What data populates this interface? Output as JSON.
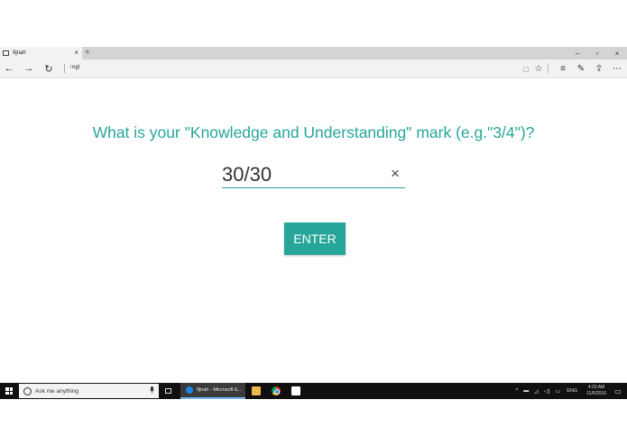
{
  "browser": {
    "tab_title": "9jnah",
    "tab_close": "×",
    "new_tab": "+",
    "window_controls": {
      "minimize": "–",
      "restore": "▫",
      "close": "×"
    },
    "address_text": "↑ngl",
    "nav": {
      "back": "←",
      "forward": "→",
      "refresh": "↻"
    },
    "toolbar_icons": {
      "reading_view": "▢",
      "favorite": "☆",
      "hub": "≡",
      "web_note": "✎",
      "share": "⇪",
      "more": "⋯"
    }
  },
  "page": {
    "question": "What is your \"Knowledge and Understanding\" mark (e.g.\"3/4\")?",
    "input_value": "30/30",
    "clear_glyph": "×",
    "enter_label": "ENTER",
    "accent_color": "#26a69a"
  },
  "taskbar": {
    "search_placeholder": "Ask me anything",
    "mic_glyph": "🎤",
    "active_app_label": "9jnah - Microsoft E...",
    "tray": {
      "chevron": "^",
      "language": "ENG",
      "time": "4:33 AM",
      "date": "11/6/2016",
      "notification_glyph": "▭"
    }
  }
}
